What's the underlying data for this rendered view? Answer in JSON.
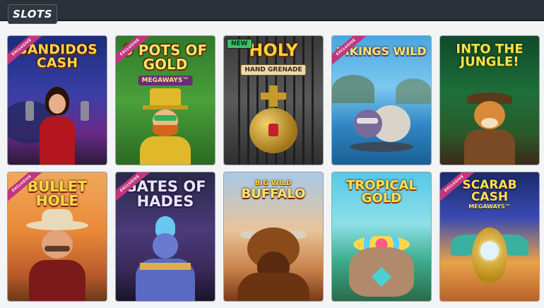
{
  "section": {
    "label": "SLOTS"
  },
  "badges": {
    "exclusive": "EXCLUSIVE",
    "new": "NEW"
  },
  "games": [
    {
      "title": "BANDIDOS CASH",
      "subtitle": "",
      "badge": "exclusive"
    },
    {
      "title": "9 POTS OF GOLD",
      "subtitle": "MEGAWAYS™",
      "badge": "exclusive"
    },
    {
      "title": "HOLY",
      "subtitle": "HAND GRENADE",
      "badge": "new"
    },
    {
      "title": "VIKINGS WILD",
      "subtitle": "",
      "badge": "exclusive"
    },
    {
      "title": "INTO THE JUNGLE!",
      "subtitle": "",
      "badge": ""
    },
    {
      "title": "BULLET HOLE",
      "subtitle": "",
      "badge": "exclusive"
    },
    {
      "title": "GATES OF HADES",
      "subtitle": "",
      "badge": "exclusive"
    },
    {
      "title": "BUFFALO",
      "subtitle": "BIG WILD",
      "badge": ""
    },
    {
      "title": "TROPICAL GOLD",
      "subtitle": "",
      "badge": ""
    },
    {
      "title": "SCARAB CASH",
      "subtitle": "MEGAWAYS™",
      "badge": "exclusive"
    }
  ]
}
